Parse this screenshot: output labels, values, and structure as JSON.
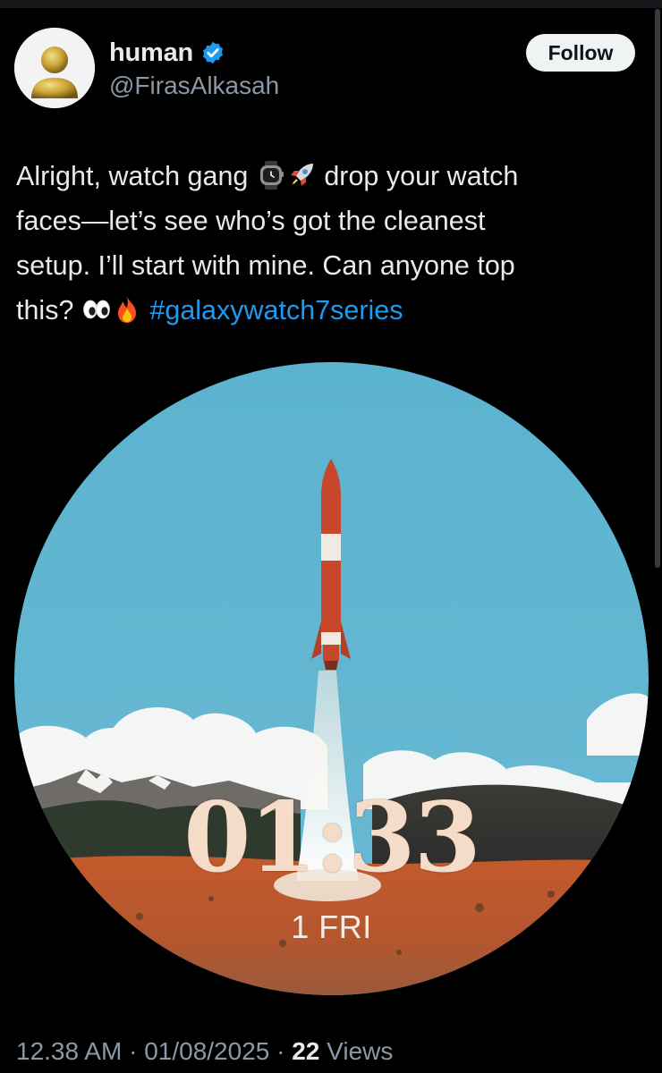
{
  "tweet": {
    "author": {
      "display_name": "human",
      "handle": "@FirasAlkasah",
      "verified": true
    },
    "follow_label": "Follow",
    "text": {
      "line1_part1": "Alright, watch gang ",
      "line1_part2": " drop your watch",
      "line2": "faces—let’s see who’s got the cleanest",
      "line3": "setup. I’ll start with mine. Can anyone top",
      "line4_part1": "this? ",
      "hashtag": "#galaxywatch7series"
    },
    "emojis": [
      "watch-emoji",
      "rocket-emoji",
      "eyes-emoji",
      "fire-emoji"
    ],
    "media": {
      "watch_face": {
        "time": "01:33",
        "date": "1 FRI"
      }
    },
    "meta": {
      "time": "12.38 AM",
      "separator": "·",
      "date": "01/08/2025",
      "views_count": "22",
      "views_label": "Views"
    }
  },
  "colors": {
    "background": "#000000",
    "text": "#e7e9ea",
    "secondary_text": "#8b98a5",
    "link": "#1d9bf0",
    "verified": "#1d9bf0",
    "follow_bg": "#eff3f4"
  }
}
